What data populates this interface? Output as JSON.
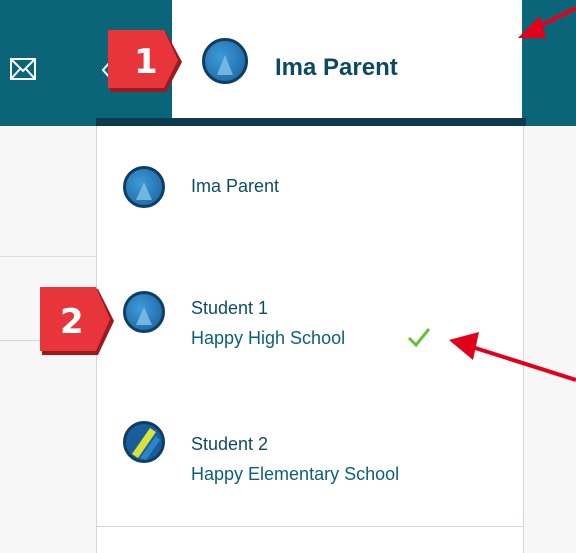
{
  "header": {
    "user_name": "Ima Parent"
  },
  "dropdown": {
    "items": [
      {
        "name": "Ima Parent",
        "school": "",
        "selected": false,
        "avatar": "parent-avatar-icon"
      },
      {
        "name": "Student 1",
        "school": "Happy High School",
        "selected": true,
        "avatar": "student1-avatar-icon"
      },
      {
        "name": "Student 2",
        "school": "Happy Elementary School",
        "selected": false,
        "avatar": "student2-avatar-icon"
      }
    ]
  },
  "annotations": {
    "callout_1": "1",
    "callout_2": "2"
  },
  "colors": {
    "topbar": "#0b6578",
    "accent_dark": "#0c3b4f",
    "check": "#6abf3a",
    "callout": "#e8343b",
    "arrow": "#e2001a"
  }
}
